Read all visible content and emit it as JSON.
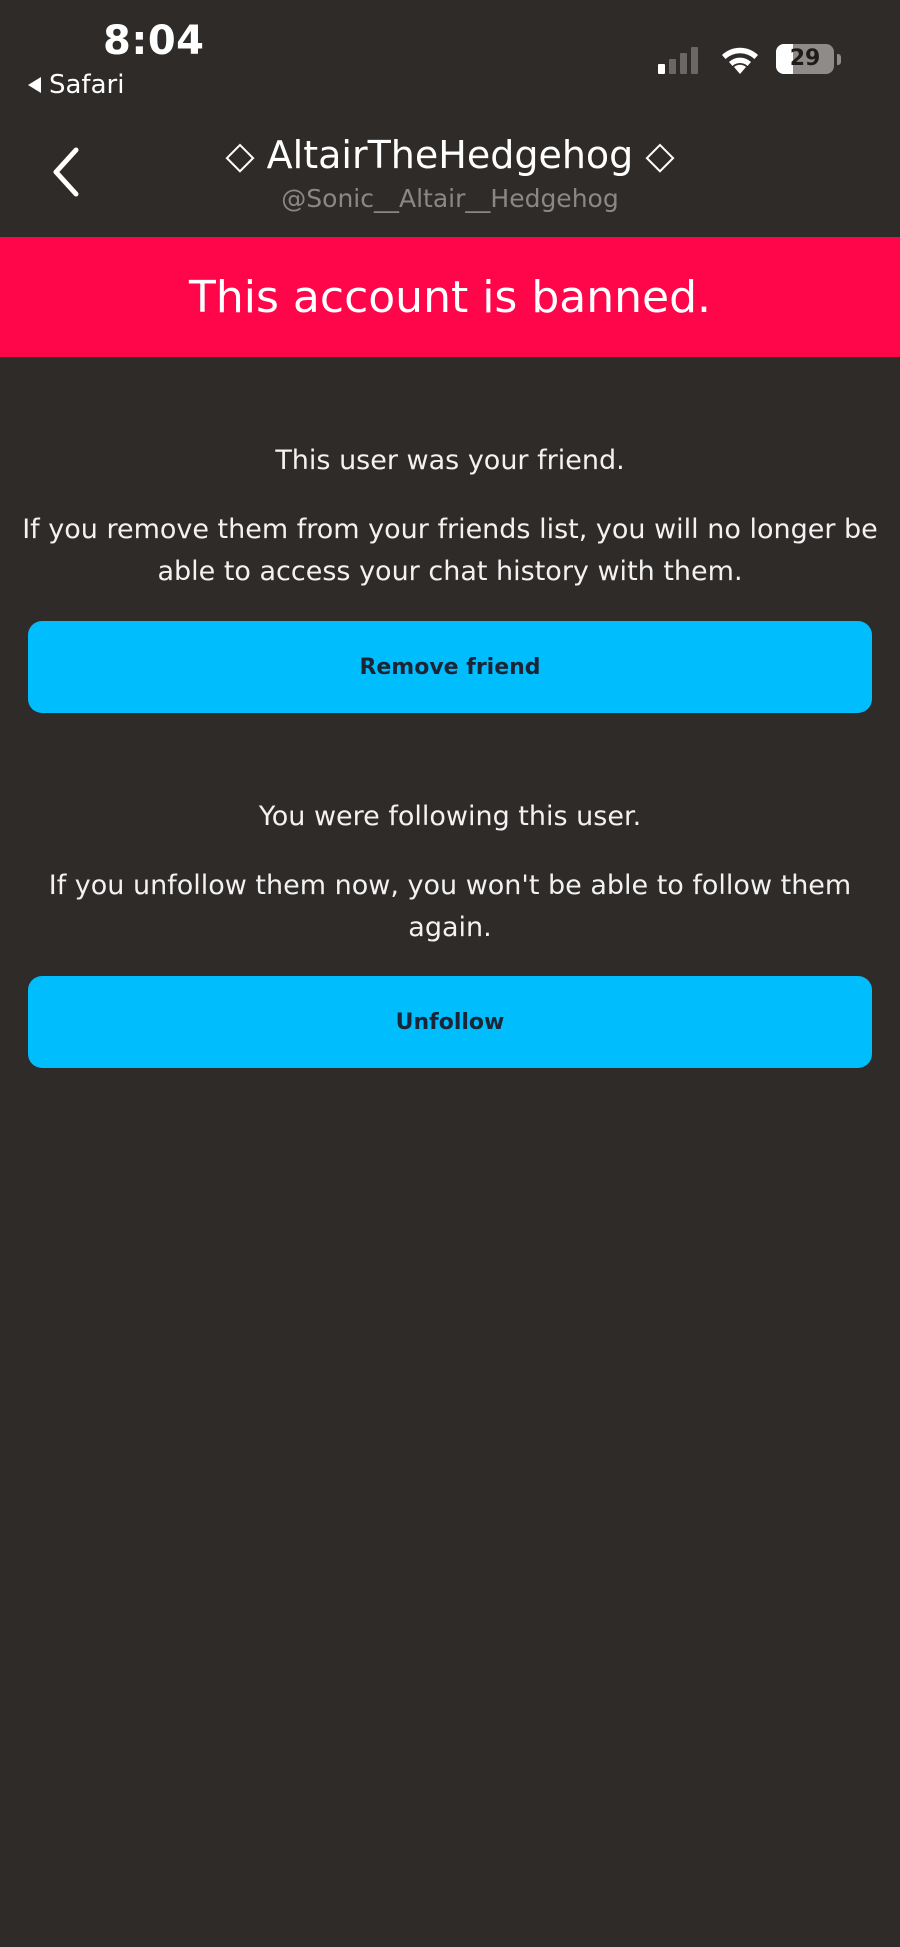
{
  "status_bar": {
    "time": "8:04",
    "back_app_label": "Safari",
    "battery_percent": "29",
    "signal_bars_active": 1,
    "signal_bars_total": 4
  },
  "header": {
    "display_name": "◇ AltairTheHedgehog ◇",
    "username": "@Sonic__Altair__Hedgehog"
  },
  "banner": {
    "text": "This account is banned.",
    "color": "#ff0549"
  },
  "friend_section": {
    "status": "This user was your friend.",
    "warning_line1": "If you remove them from your friends list, you will no longer be",
    "warning_line2": "able to access your chat history with them.",
    "button_label": "Remove friend"
  },
  "follow_section": {
    "status": "You were following this user.",
    "warning_line1": "If you unfollow them now, you won't be able to follow them",
    "warning_line2": "again.",
    "button_label": "Unfollow"
  },
  "colors": {
    "background": "#2f2b29",
    "button": "#00bdfd",
    "button_text": "#1a2535"
  }
}
